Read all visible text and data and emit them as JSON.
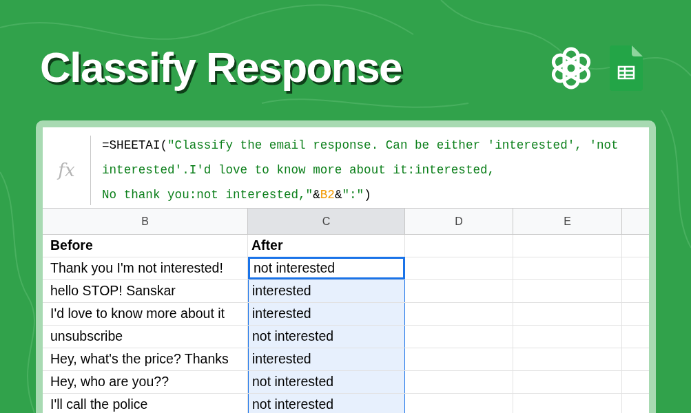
{
  "title": "Classify Response",
  "formula_bar": {
    "icon": "fx",
    "lines": [
      [
        {
          "kind": "plain",
          "text": "=SHEETAI("
        },
        {
          "kind": "string",
          "text": "\"Classify the email response. Can be either 'interested', 'not"
        }
      ],
      [
        {
          "kind": "string",
          "text": "interested'.I'd love to know more about it:interested,"
        }
      ],
      [
        {
          "kind": "string",
          "text": "No thank you:not interested,\""
        },
        {
          "kind": "plain",
          "text": "&"
        },
        {
          "kind": "ref",
          "text": "B2"
        },
        {
          "kind": "plain",
          "text": "&"
        },
        {
          "kind": "string",
          "text": "\":\""
        },
        {
          "kind": "plain",
          "text": ")"
        }
      ]
    ]
  },
  "columns": [
    {
      "label": "B",
      "selected": false
    },
    {
      "label": "C",
      "selected": true
    },
    {
      "label": "D",
      "selected": false
    },
    {
      "label": "E",
      "selected": false
    }
  ],
  "header_row": {
    "before": "Before",
    "after": "After"
  },
  "rows": [
    {
      "before": "Thank you I'm not interested!",
      "after": "not interested",
      "selected": true
    },
    {
      "before": "hello STOP! Sanskar",
      "after": "interested",
      "selected": false
    },
    {
      "before": "I'd love to know more about it",
      "after": "interested",
      "selected": false
    },
    {
      "before": "unsubscribe",
      "after": "not interested",
      "selected": false
    },
    {
      "before": "Hey, what's the price? Thanks",
      "after": "interested",
      "selected": false
    },
    {
      "before": "Hey, who are you??",
      "after": "not interested",
      "selected": false
    },
    {
      "before": "I'll call the police",
      "after": "not interested",
      "selected": false
    }
  ]
}
